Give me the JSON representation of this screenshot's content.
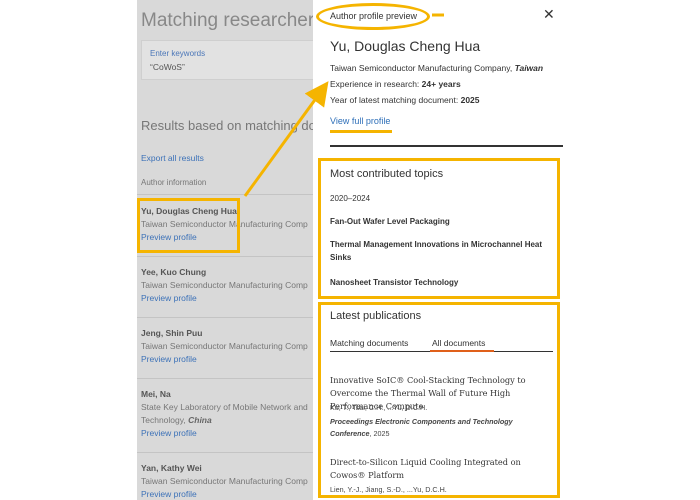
{
  "background": {
    "title": "Matching researchers",
    "keywords_label": "Enter keywords",
    "keywords_value": "“CoWoS”",
    "results_heading": "Results based on matching do",
    "export_all": "Export all results",
    "author_info_label": "Author information",
    "researchers": [
      {
        "name": "Yu, Douglas Cheng Hua",
        "affiliation": "Taiwan Semiconductor Manufacturing Comp",
        "preview": "Preview profile"
      },
      {
        "name": "Yee, Kuo Chung",
        "affiliation": "Taiwan Semiconductor Manufacturing Comp",
        "preview": "Preview profile"
      },
      {
        "name": "Jeng, Shin Puu",
        "affiliation": "Taiwan Semiconductor Manufacturing Comp",
        "preview": "Preview profile"
      },
      {
        "name": "Mei, Na",
        "affiliation": "State Key Laboratory of Mobile Network and Technology,",
        "affiliation_country": "China",
        "preview": "Preview profile"
      },
      {
        "name": "Yan, Kathy Wei",
        "affiliation": "Taiwan Semiconductor Manufacturing Comp",
        "preview": "Preview profile"
      }
    ]
  },
  "panel": {
    "header": "Author profile preview",
    "close": "✕",
    "author_name": "Yu, Douglas Cheng Hua",
    "affiliation": "Taiwan Semiconductor Manufacturing Company,",
    "country": "Taiwan",
    "experience_label": "Experience in research:",
    "experience_value": "24+ years",
    "latest_label": "Year of latest matching document:",
    "latest_value": "2025",
    "view_full": "View full profile",
    "topics": {
      "title": "Most contributed topics",
      "period": "2020–2024",
      "items": [
        "Fan-Out Wafer Level Packaging",
        "Thermal Management Innovations in Microchannel Heat Sinks",
        "Nanosheet Transistor Technology"
      ]
    },
    "publications": {
      "title": "Latest publications",
      "tabs": [
        "Matching documents",
        "All documents"
      ],
      "items": [
        {
          "title": "Innovative SoIC® Cool-Stacking Technology to Overcome the Thermal Wall of Future High Performance Compute",
          "authors": "Ku, T., Tsai, C.H., ...Yu, D.C.H.",
          "venue": "Proceedings Electronic Components and Technology Conference",
          "year": ", 2025"
        },
        {
          "title": "Direct-to-Silicon Liquid Cooling Integrated on Cowos® Platform",
          "authors": "Lien, Y.-J., Jiang, S.-D., ...Yu, D.C.H."
        }
      ]
    }
  },
  "colors": {
    "highlight": "#f5b400",
    "link": "#2e6fb8",
    "tab_active": "#e0601a"
  }
}
